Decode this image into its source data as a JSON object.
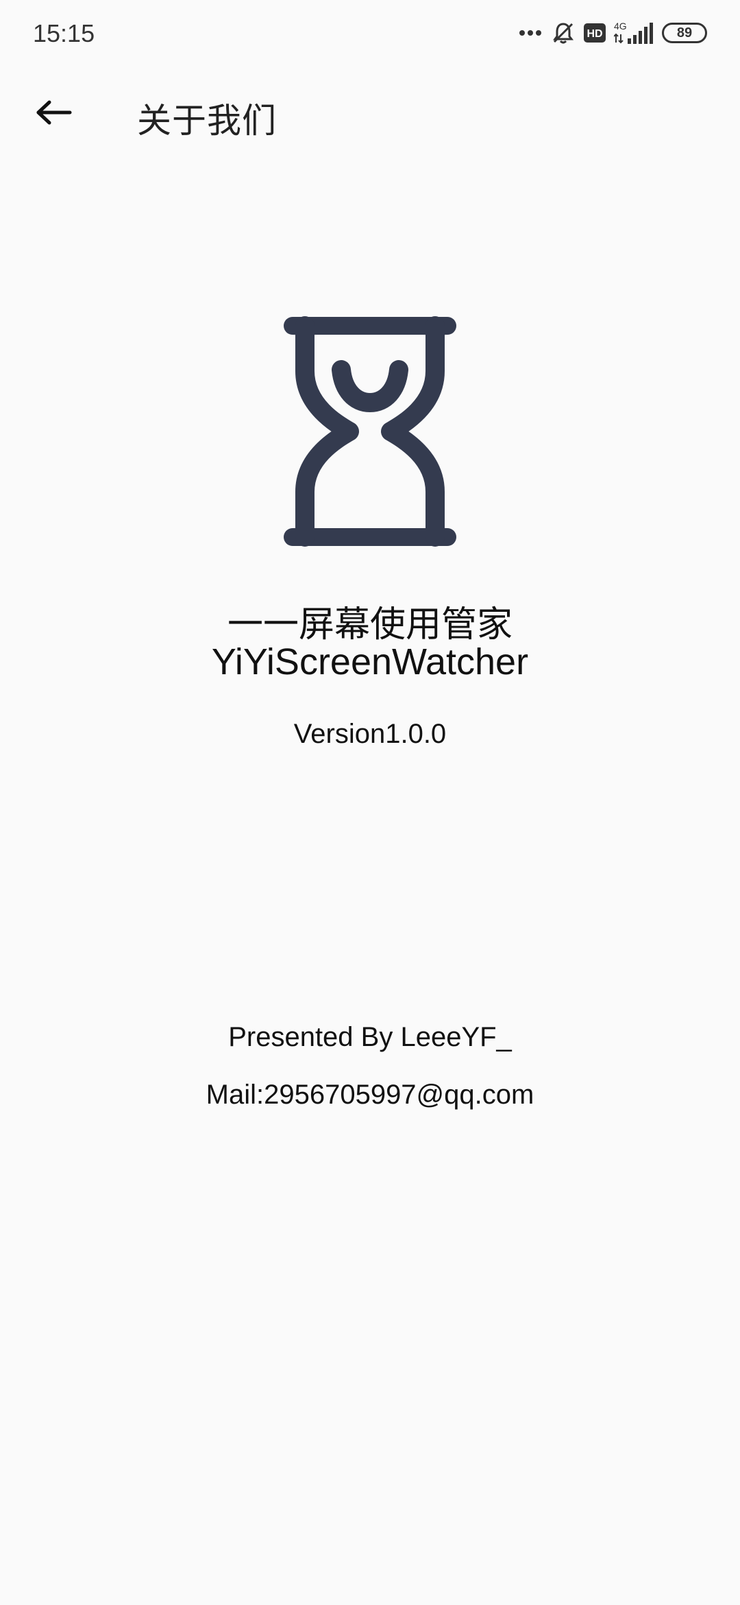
{
  "status_bar": {
    "time": "15:15",
    "network": "4G",
    "hd_badge": "HD",
    "battery": "89",
    "icons": [
      "more-dots-icon",
      "silent-bell-icon",
      "hd-icon",
      "signal-4g-icon",
      "battery-icon"
    ]
  },
  "app_bar": {
    "back_icon": "back-arrow-icon",
    "title": "关于我们"
  },
  "about": {
    "logo_icon": "hourglass-icon",
    "logo_color": "#343b4f",
    "app_name_cn": "一一屏幕使用管家",
    "app_name_en": "YiYiScreenWatcher",
    "version": "Version1.0.0",
    "presented_by": "Presented By LeeeYF_",
    "mail": "Mail:2956705997@qq.com"
  }
}
